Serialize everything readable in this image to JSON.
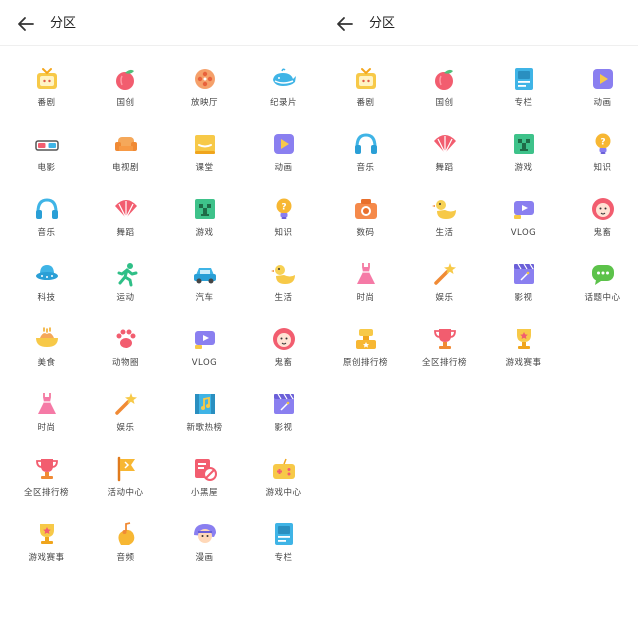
{
  "left": {
    "title": "分区",
    "items": [
      {
        "label": "番剧",
        "icon": "tv-icon"
      },
      {
        "label": "国创",
        "icon": "peach-icon"
      },
      {
        "label": "放映厅",
        "icon": "film-reel-icon"
      },
      {
        "label": "纪录片",
        "icon": "whale-icon"
      },
      {
        "label": "电影",
        "icon": "3d-glasses-icon"
      },
      {
        "label": "电视剧",
        "icon": "sofa-icon"
      },
      {
        "label": "课堂",
        "icon": "classroom-icon"
      },
      {
        "label": "动画",
        "icon": "play-icon"
      },
      {
        "label": "音乐",
        "icon": "headphones-icon"
      },
      {
        "label": "舞蹈",
        "icon": "fan-icon"
      },
      {
        "label": "游戏",
        "icon": "creeper-icon"
      },
      {
        "label": "知识",
        "icon": "lightbulb-icon"
      },
      {
        "label": "科技",
        "icon": "ufo-icon"
      },
      {
        "label": "运动",
        "icon": "runner-icon"
      },
      {
        "label": "汽车",
        "icon": "car-icon"
      },
      {
        "label": "生活",
        "icon": "duck-icon"
      },
      {
        "label": "美食",
        "icon": "food-icon"
      },
      {
        "label": "动物圈",
        "icon": "paw-icon"
      },
      {
        "label": "VLOG",
        "icon": "vlog-icon"
      },
      {
        "label": "鬼畜",
        "icon": "lion-icon"
      },
      {
        "label": "时尚",
        "icon": "dress-icon"
      },
      {
        "label": "娱乐",
        "icon": "magic-wand-icon"
      },
      {
        "label": "新歌热榜",
        "icon": "music-film-icon"
      },
      {
        "label": "影视",
        "icon": "clapper-icon"
      },
      {
        "label": "全区排行榜",
        "icon": "trophy-icon"
      },
      {
        "label": "活动中心",
        "icon": "flag-icon"
      },
      {
        "label": "小黑屋",
        "icon": "ban-icon"
      },
      {
        "label": "游戏中心",
        "icon": "gamepad-icon"
      },
      {
        "label": "游戏赛事",
        "icon": "cup-icon"
      },
      {
        "label": "音频",
        "icon": "music-note-icon"
      },
      {
        "label": "漫画",
        "icon": "comic-icon"
      },
      {
        "label": "专栏",
        "icon": "article-icon"
      }
    ]
  },
  "right": {
    "title": "分区",
    "items": [
      {
        "label": "番剧",
        "icon": "tv-icon"
      },
      {
        "label": "国创",
        "icon": "peach-icon"
      },
      {
        "label": "专栏",
        "icon": "article-icon"
      },
      {
        "label": "动画",
        "icon": "play-icon"
      },
      {
        "label": "音乐",
        "icon": "headphones-icon"
      },
      {
        "label": "舞蹈",
        "icon": "fan-icon"
      },
      {
        "label": "游戏",
        "icon": "creeper-icon"
      },
      {
        "label": "知识",
        "icon": "lightbulb-icon"
      },
      {
        "label": "数码",
        "icon": "camera-icon"
      },
      {
        "label": "生活",
        "icon": "duck-icon"
      },
      {
        "label": "VLOG",
        "icon": "vlog-icon"
      },
      {
        "label": "鬼畜",
        "icon": "lion-icon"
      },
      {
        "label": "时尚",
        "icon": "dress-icon"
      },
      {
        "label": "娱乐",
        "icon": "magic-wand-icon"
      },
      {
        "label": "影视",
        "icon": "clapper-icon"
      },
      {
        "label": "话题中心",
        "icon": "chat-icon"
      },
      {
        "label": "原创排行榜",
        "icon": "podium-icon"
      },
      {
        "label": "全区排行榜",
        "icon": "trophy-icon"
      },
      {
        "label": "游戏赛事",
        "icon": "cup-icon"
      }
    ]
  },
  "colors": {
    "text": "#444444",
    "title": "#222222",
    "divider": "#efefef"
  }
}
